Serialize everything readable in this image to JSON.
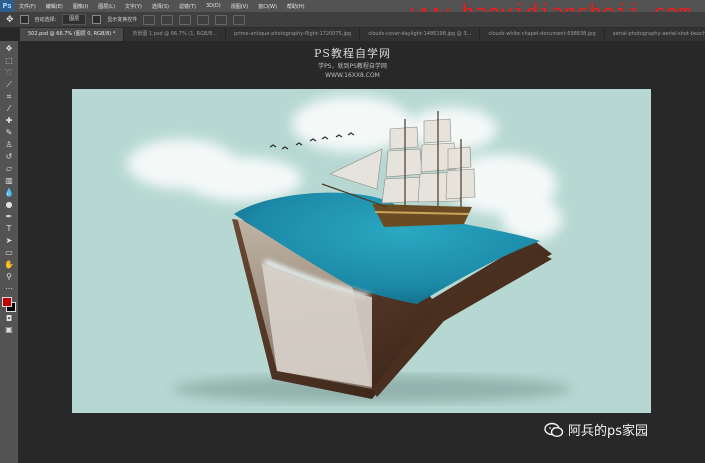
{
  "app": {
    "logo": "Ps"
  },
  "menu": [
    "文件(F)",
    "编辑(E)",
    "图像(I)",
    "图层(L)",
    "文字(Y)",
    "选择(S)",
    "滤镜(T)",
    "3D(D)",
    "视图(V)",
    "窗口(W)",
    "帮助(H)"
  ],
  "watermark_url": "www.haoyidiansheji.com",
  "options": {
    "auto_select_label": "自动选择:",
    "auto_select_value": "图层",
    "transform_label": "显示变换控件"
  },
  "tabs": [
    {
      "label": "502.psd @ 66.7% (图层 0, RGB/8) *",
      "active": true
    },
    {
      "label": "背景图 1.psd @ 66.7% (1, RGB/8..."
    },
    {
      "label": "prime-antique-photography-flight-1720075.jpg"
    },
    {
      "label": "clouds-cover-daylight-1486198.jpg @ 3..."
    },
    {
      "label": "clouds-white-chapel-document-698838.jpg"
    },
    {
      "label": "aerial-photography-aerial-shot-beach"
    }
  ],
  "overlay": {
    "title": "PS教程自学网",
    "subtitle1": "学PS，就到PS教程自学网",
    "subtitle2": "WWW.16XX8.COM"
  },
  "wechat_label": "阿兵的ps家园",
  "colors": {
    "foreground": "#c00000",
    "background": "#000000",
    "canvas": "#b7d8d2",
    "accent": "#e8201e"
  }
}
